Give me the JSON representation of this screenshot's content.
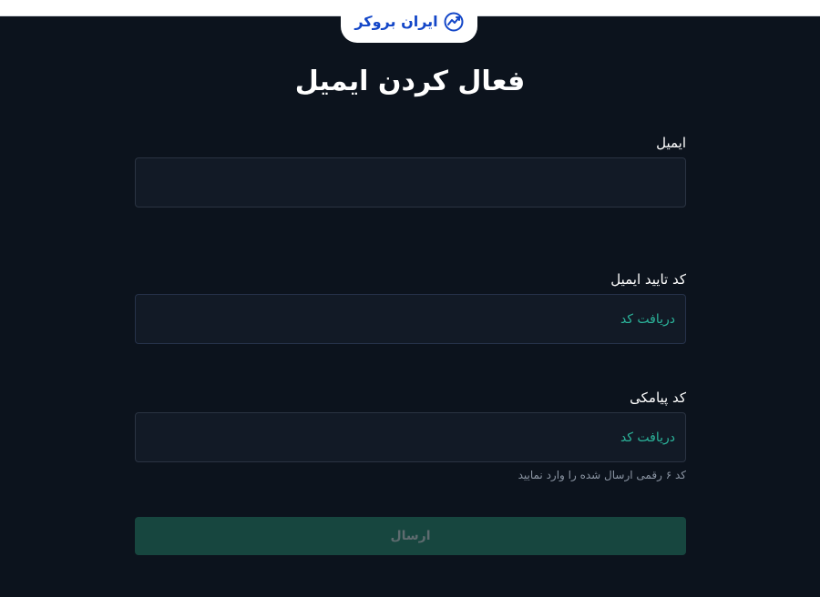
{
  "brand": {
    "logo_text": "ایران بروکر",
    "color": "#1447c8"
  },
  "page": {
    "title": "فعال کردن ایمیل"
  },
  "form": {
    "email": {
      "label": "ایمیل",
      "value": "",
      "placeholder": ""
    },
    "email_code": {
      "label": "کد تایید ایمیل",
      "value": "",
      "action_label": "دریافت کد"
    },
    "sms_code": {
      "label": "کد پیامکی",
      "value": "",
      "action_label": "دریافت کد",
      "hint": "کد ۶ رقمی ارسال شده را وارد نمایید"
    },
    "submit_label": "ارسال"
  },
  "colors": {
    "background": "#0c131d",
    "accent": "#2bb39a",
    "button_disabled": "#17463f"
  }
}
